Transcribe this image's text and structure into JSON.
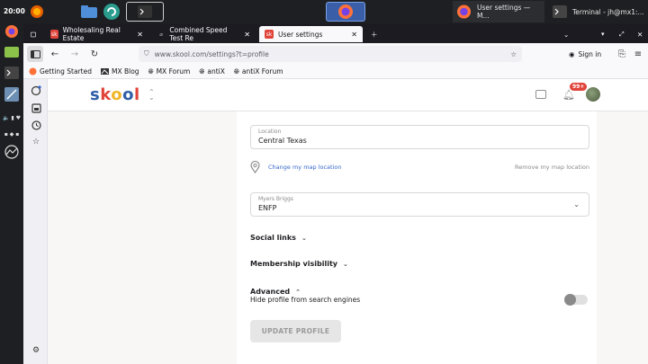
{
  "taskbar": {
    "clock": "20:00",
    "tasks": [
      {
        "label": "User settings — M..."
      },
      {
        "label": "Terminal - jh@mx1:..."
      }
    ]
  },
  "browser": {
    "tabs": [
      {
        "label": "Wholesaling Real Estate",
        "favicon": "sk"
      },
      {
        "label": "Combined Speed Test Re"
      },
      {
        "label": "User settings",
        "favicon": "sk"
      }
    ],
    "url": "www.skool.com/settings?t=profile",
    "signin_label": "Sign in",
    "bookmarks": [
      "Getting Started",
      "MX Blog",
      "MX Forum",
      "antiX",
      "antiX Forum"
    ]
  },
  "site": {
    "logo_letters": [
      "s",
      "k",
      "o",
      "o",
      "l"
    ],
    "logo_colors": [
      "#2e5ea8",
      "#e0443a",
      "#f0b429",
      "#2e5ea8",
      "#e0443a"
    ],
    "notification_count": "99+"
  },
  "form": {
    "location_label": "Location",
    "location_value": "Central Texas",
    "change_map_label": "Change my map location",
    "remove_map_label": "Remove my map location",
    "myers_label": "Myers Briggs",
    "myers_value": "ENFP",
    "social_links": "Social links",
    "membership_visibility": "Membership visibility",
    "advanced": "Advanced",
    "hide_profile_label": "Hide profile from search engines",
    "hide_profile_on": false,
    "update_button": "UPDATE PROFILE"
  },
  "colors": {
    "accent_blue": "#3568c9",
    "badge_red": "#e0443a"
  }
}
